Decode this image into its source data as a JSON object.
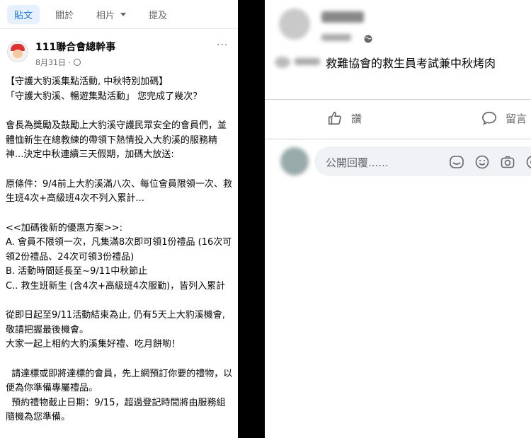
{
  "tabs": [
    {
      "label": "貼文",
      "active": true
    },
    {
      "label": "關於",
      "active": false
    },
    {
      "label": "相片",
      "active": false
    },
    {
      "label": "提及",
      "active": false
    }
  ],
  "post": {
    "author": "111聯合會總幹事",
    "date": "8月31日 ·",
    "more": "···",
    "lines": [
      "【守護大豹溪集點活動, 中秋特別加碼】",
      "「守護大豹溪、暢遊集點活動」 您完成了幾次？",
      "",
      "會長為獎勵及鼓勵上大豹溪守護民眾安全的會員們，並體恤新生在總教練的帶領下熱情投入大豹溪的服務精神...決定中秋連續三天假期，加碼大放送:",
      "",
      "原條件：9/4前上大豹溪滿八次、每位會員限領一次、救生班4次+高級班4次不列入累計...",
      "",
      "<<加碼後新的優惠方案>>:",
      "A. 會員不限領一次，凡集滿8次即可領1份禮品 (16次可領2份禮品、24次可領3份禮品)",
      "B. 活動時間延長至~9/11中秋節止",
      "C.. 救生班新生 (含4次+高級班4次服勤)，皆列入累計",
      "",
      "從即日起至9/11活動結束為止, 仍有5天上大豹溪機會, 敬請把握最後機會。",
      "大家一起上相約大豹溪集好禮、吃月餅喲！",
      "",
      "  請達標或即將達標的會員，先上網預訂你要的禮物，以便為你準備專屬禮品。",
      "  預約禮物截止日期：9/15，超過登記時間將由服務組隨機為您準備。"
    ]
  },
  "right": {
    "comment_text": "救難協會的救生員考試兼中秋烤肉",
    "like_label": "讚",
    "comment_label": "留言",
    "reply_placeholder": "公開回覆......"
  },
  "icons": [
    "globe-icon",
    "like-icon",
    "comment-icon",
    "sticker-icon",
    "emoji-icon",
    "camera-icon",
    "gif-icon"
  ]
}
